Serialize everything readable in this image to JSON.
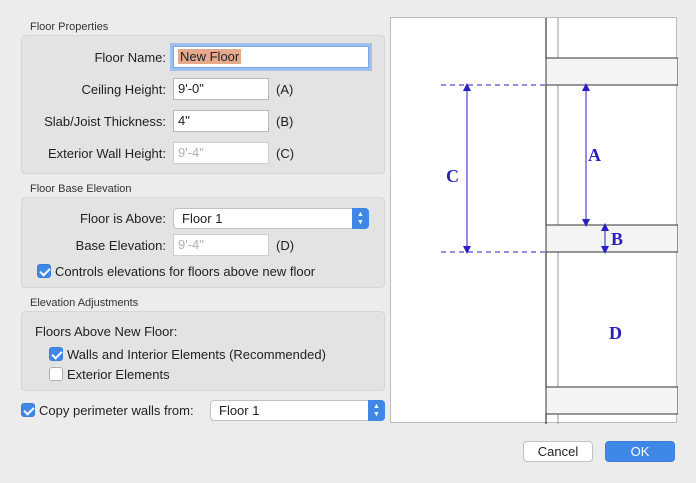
{
  "floor_properties": {
    "title": "Floor Properties",
    "floor_name_label": "Floor Name:",
    "floor_name_value": "New Floor",
    "ceiling_height_label": "Ceiling Height:",
    "ceiling_height_value": "9'-0\"",
    "ceiling_height_tag": "(A)",
    "slab_label": "Slab/Joist Thickness:",
    "slab_value": "4\"",
    "slab_tag": "(B)",
    "exterior_wall_label": "Exterior Wall Height:",
    "exterior_wall_value": "9'-4\"",
    "exterior_wall_tag": "(C)"
  },
  "floor_base_elevation": {
    "title": "Floor Base Elevation",
    "floor_above_label": "Floor is Above:",
    "floor_above_value": "Floor 1",
    "base_elevation_label": "Base Elevation:",
    "base_elevation_value": "9'-4\"",
    "base_elevation_tag": "(D)",
    "controls_elevations_label": "Controls elevations for floors above new floor",
    "controls_elevations_checked": true
  },
  "elevation_adjustments": {
    "title": "Elevation Adjustments",
    "floors_above_label": "Floors Above New Floor:",
    "walls_interior_label": "Walls and Interior Elements (Recommended)",
    "walls_interior_checked": true,
    "exterior_elements_label": "Exterior Elements",
    "exterior_elements_checked": false
  },
  "copy_perimeter": {
    "label": "Copy perimeter walls from:",
    "checked": true,
    "value": "Floor 1"
  },
  "diagram": {
    "label_a": "A",
    "label_b": "B",
    "label_c": "C",
    "label_d": "D",
    "accent_color": "#2a1fc4"
  },
  "buttons": {
    "cancel": "Cancel",
    "ok": "OK"
  }
}
